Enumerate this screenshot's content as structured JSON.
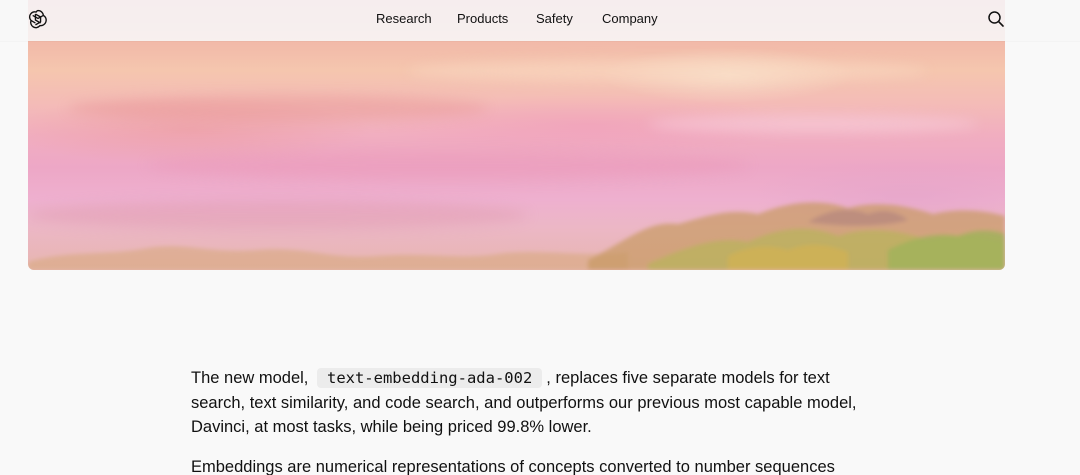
{
  "header": {
    "logo_icon": "openai-logo-icon",
    "nav_items": [
      "Research",
      "Products",
      "Safety",
      "Company"
    ],
    "search_icon": "search-icon"
  },
  "hero": {
    "image_description_icon": "watercolor-hero-image",
    "colors": [
      "#e9a4aa",
      "#f5c6ae",
      "#f1aec0",
      "#eeb0cf",
      "#c7b76a"
    ]
  },
  "article": {
    "paragraph1": {
      "lead": "The new model, ",
      "code": "text-embedding-ada-002",
      "rest": ", replaces five separate models for text search, text similarity, and code search, and outperforms our previous most capable model, Davinci, at most tasks, while being priced 99.8% lower."
    },
    "paragraph2": "Embeddings are numerical representations of concepts converted to number sequences"
  }
}
